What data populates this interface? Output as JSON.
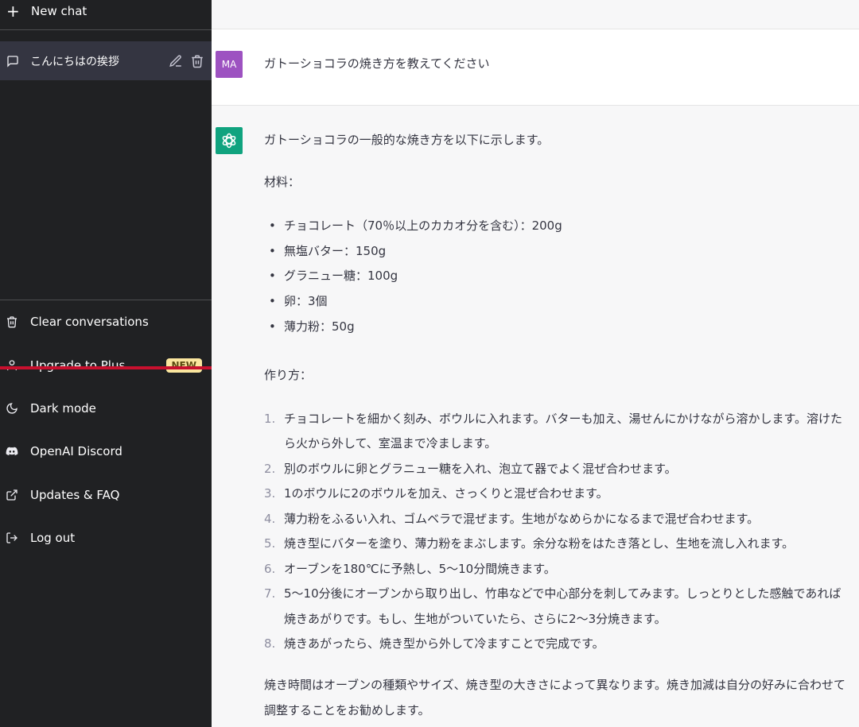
{
  "sidebar": {
    "new_chat_label": "New chat",
    "conversations": [
      {
        "title": "こんにちはの挨拶"
      }
    ],
    "menu": [
      {
        "label": "Clear conversations",
        "icon": "trash-icon"
      },
      {
        "label": "Upgrade to Plus",
        "icon": "user-icon",
        "badge": "NEW"
      },
      {
        "label": "Dark mode",
        "icon": "moon-icon"
      },
      {
        "label": "OpenAI Discord",
        "icon": "discord-icon"
      },
      {
        "label": "Updates & FAQ",
        "icon": "external-link-icon"
      },
      {
        "label": "Log out",
        "icon": "logout-icon"
      }
    ]
  },
  "chat": {
    "user_avatar": "MA",
    "user_message": "ガトーショコラの焼き方を教えてください",
    "assistant": {
      "intro": "ガトーショコラの一般的な焼き方を以下に示します。",
      "ingredients_title": "材料：",
      "ingredients": [
        "チョコレート（70％以上のカカオ分を含む）：200g",
        "無塩バター：150g",
        "グラニュー糖：100g",
        "卵：3個",
        "薄力粉：50g"
      ],
      "steps_title": "作り方：",
      "steps": [
        {
          "num": "1.",
          "text": "チョコレートを細かく刻み、ボウルに入れます。バターも加え、湯せんにかけながら溶かします。溶けたら火から外して、室温まで冷まします。"
        },
        {
          "num": "2.",
          "text": "別のボウルに卵とグラニュー糖を入れ、泡立て器でよく混ぜ合わせます。"
        },
        {
          "num": "3.",
          "text": "1のボウルに2のボウルを加え、さっくりと混ぜ合わせます。"
        },
        {
          "num": "4.",
          "text": "薄力粉をふるい入れ、ゴムベラで混ぜます。生地がなめらかになるまで混ぜ合わせます。"
        },
        {
          "num": "5.",
          "text": "焼き型にバターを塗り、薄力粉をまぶします。余分な粉をはたき落とし、生地を流し入れます。"
        },
        {
          "num": "6.",
          "text": "オーブンを180℃に予熱し、5〜10分間焼きます。"
        },
        {
          "num": "7.",
          "text": "5〜10分後にオーブンから取り出し、竹串などで中心部分を刺してみます。しっとりとした感触であれば焼きあがりです。もし、生地がついていたら、さらに2〜3分焼きます。"
        },
        {
          "num": "8.",
          "text": "焼きあがったら、焼き型から外して冷ますことで完成です。"
        }
      ],
      "closing": "焼き時間はオーブンの種類やサイズ、焼き型の大きさによって異なります。焼き加減は自分の好みに合わせて調整することをお勧めします。"
    }
  },
  "colors": {
    "sidebar_bg": "#202123",
    "selected_bg": "#343541",
    "user_avatar_bg": "#9d52c1",
    "gpt_avatar_bg": "#10a37f",
    "badge_bg": "#fae69e",
    "annotation_line": "#c8102e"
  }
}
